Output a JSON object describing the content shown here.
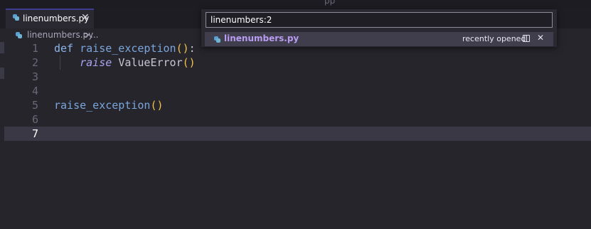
{
  "tab": {
    "label": "linenumbers.py",
    "close": "✕"
  },
  "breadcrumb": {
    "file": "linenumbers.py",
    "separator": ">",
    "more": "..."
  },
  "editor": {
    "current_line": 7,
    "lines": [
      {
        "number": "1"
      },
      {
        "number": "2"
      },
      {
        "number": "3"
      },
      {
        "number": "4"
      },
      {
        "number": "5"
      },
      {
        "number": "6"
      },
      {
        "number": "7"
      }
    ],
    "tokens": {
      "l1_kw": "def",
      "l1_fn": "raise_exception",
      "l1_paren": "()",
      "l1_colon": ":",
      "l2_kw": "raise",
      "l2_name": "ValueError",
      "l2_paren": "()",
      "l5_fn": "raise_exception",
      "l5_paren": "()"
    }
  },
  "quick_open": {
    "input_value": "linenumbers:2",
    "result": {
      "label": "linenumbers.py",
      "description": "recently opened",
      "close": "✕"
    }
  }
}
